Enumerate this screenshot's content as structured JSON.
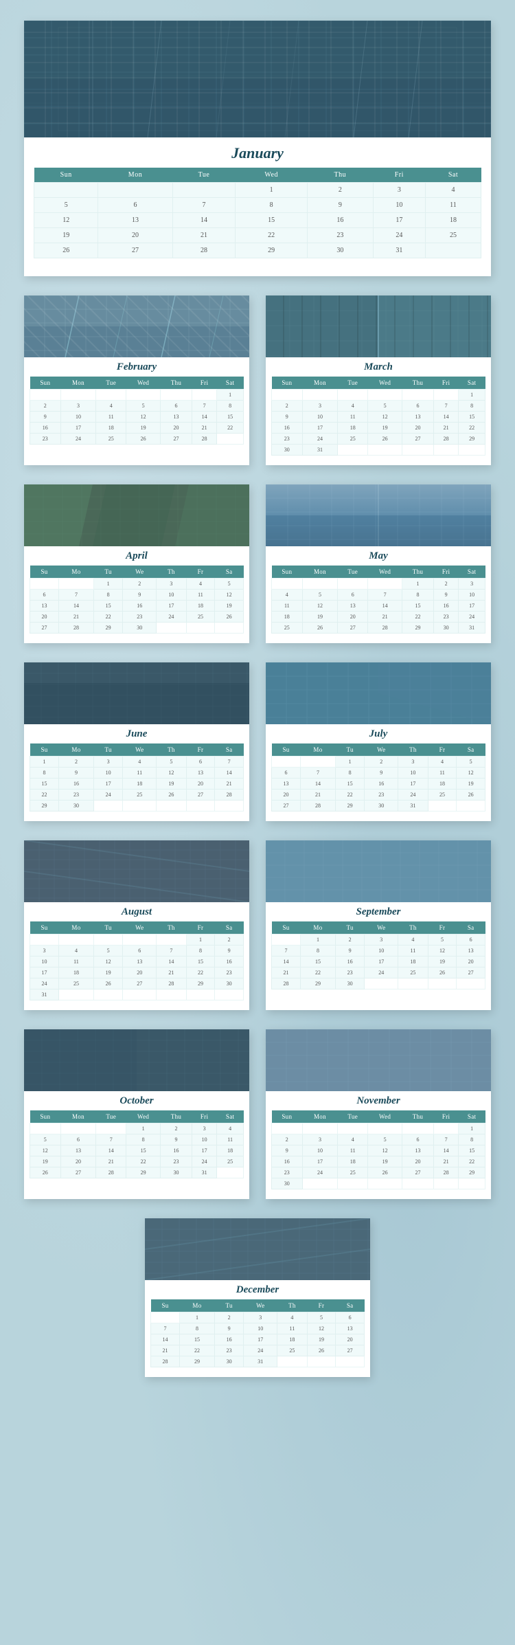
{
  "months": {
    "january": {
      "name": "January",
      "headers_full": [
        "Sun",
        "Mon",
        "Tue",
        "Wed",
        "Thu",
        "Fri",
        "Sat"
      ],
      "weeks": [
        [
          "",
          "",
          "",
          "1",
          "2",
          "3",
          "4"
        ],
        [
          "5",
          "6",
          "7",
          "8",
          "9",
          "10",
          "11"
        ],
        [
          "12",
          "13",
          "14",
          "15",
          "16",
          "17",
          "18"
        ],
        [
          "19",
          "20",
          "21",
          "22",
          "23",
          "24",
          "25"
        ],
        [
          "26",
          "27",
          "28",
          "29",
          "30",
          "31",
          ""
        ]
      ]
    },
    "february": {
      "name": "February",
      "headers": [
        "Sun",
        "Mon",
        "Tue",
        "Wed",
        "Thu",
        "Fri",
        "Sat"
      ],
      "weeks": [
        [
          "",
          "",
          "",
          "",
          "",
          "",
          "1"
        ],
        [
          "2",
          "3",
          "4",
          "5",
          "6",
          "7",
          "8"
        ],
        [
          "9",
          "10",
          "11",
          "12",
          "13",
          "14",
          "15"
        ],
        [
          "16",
          "17",
          "18",
          "19",
          "20",
          "21",
          "22"
        ],
        [
          "23",
          "24",
          "25",
          "26",
          "27",
          "28",
          ""
        ]
      ]
    },
    "march": {
      "name": "March",
      "headers": [
        "Sun",
        "Mon",
        "Tue",
        "Wed",
        "Thu",
        "Fri",
        "Sat"
      ],
      "weeks": [
        [
          "",
          "",
          "",
          "",
          "",
          "",
          "1"
        ],
        [
          "2",
          "3",
          "4",
          "5",
          "6",
          "7",
          "8"
        ],
        [
          "9",
          "10",
          "11",
          "12",
          "13",
          "14",
          "15"
        ],
        [
          "16",
          "17",
          "18",
          "19",
          "20",
          "21",
          "22"
        ],
        [
          "23",
          "24",
          "25",
          "26",
          "27",
          "28",
          "29"
        ],
        [
          "30",
          "31",
          "",
          "",
          "",
          "",
          ""
        ]
      ]
    },
    "april": {
      "name": "April",
      "headers": [
        "Su",
        "Mo",
        "Tu",
        "We",
        "Th",
        "Fr",
        "Sa"
      ],
      "weeks": [
        [
          "",
          "",
          "1",
          "2",
          "3",
          "4",
          "5"
        ],
        [
          "6",
          "7",
          "8",
          "9",
          "10",
          "11",
          "12"
        ],
        [
          "13",
          "14",
          "15",
          "16",
          "17",
          "18",
          "19"
        ],
        [
          "20",
          "21",
          "22",
          "23",
          "24",
          "25",
          "26"
        ],
        [
          "27",
          "28",
          "29",
          "30",
          "",
          "",
          ""
        ]
      ]
    },
    "may": {
      "name": "May",
      "headers": [
        "Sun",
        "Mon",
        "Tue",
        "Wed",
        "Thu",
        "Fri",
        "Sat"
      ],
      "weeks": [
        [
          "",
          "",
          "",
          "",
          "1",
          "2",
          "3"
        ],
        [
          "4",
          "5",
          "6",
          "7",
          "8",
          "9",
          "10"
        ],
        [
          "11",
          "12",
          "13",
          "14",
          "15",
          "16",
          "17"
        ],
        [
          "18",
          "19",
          "20",
          "21",
          "22",
          "23",
          "24"
        ],
        [
          "25",
          "26",
          "27",
          "28",
          "29",
          "30",
          "31"
        ]
      ]
    },
    "june": {
      "name": "June",
      "headers": [
        "Su",
        "Mo",
        "Tu",
        "We",
        "Th",
        "Fr",
        "Sa"
      ],
      "weeks": [
        [
          "1",
          "2",
          "3",
          "4",
          "5",
          "6",
          "7"
        ],
        [
          "8",
          "9",
          "10",
          "11",
          "12",
          "13",
          "14"
        ],
        [
          "15",
          "16",
          "17",
          "18",
          "19",
          "20",
          "21"
        ],
        [
          "22",
          "23",
          "24",
          "25",
          "26",
          "27",
          "28"
        ],
        [
          "29",
          "30",
          "",
          "",
          "",
          "",
          ""
        ]
      ]
    },
    "july": {
      "name": "July",
      "headers": [
        "Su",
        "Mo",
        "Tu",
        "We",
        "Th",
        "Fr",
        "Sa"
      ],
      "weeks": [
        [
          "",
          "",
          "1",
          "2",
          "3",
          "4",
          "5"
        ],
        [
          "6",
          "7",
          "8",
          "9",
          "10",
          "11",
          "12"
        ],
        [
          "13",
          "14",
          "15",
          "16",
          "17",
          "18",
          "19"
        ],
        [
          "20",
          "21",
          "22",
          "23",
          "24",
          "25",
          "26"
        ],
        [
          "27",
          "28",
          "29",
          "30",
          "31",
          "",
          ""
        ]
      ]
    },
    "august": {
      "name": "August",
      "headers": [
        "Su",
        "Mo",
        "Tu",
        "We",
        "Th",
        "Fr",
        "Sa"
      ],
      "weeks": [
        [
          "",
          "",
          "",
          "",
          "",
          "1",
          "2"
        ],
        [
          "3",
          "4",
          "5",
          "6",
          "7",
          "8",
          "9"
        ],
        [
          "10",
          "11",
          "12",
          "13",
          "14",
          "15",
          "16"
        ],
        [
          "17",
          "18",
          "19",
          "20",
          "21",
          "22",
          "23"
        ],
        [
          "24",
          "25",
          "26",
          "27",
          "28",
          "29",
          "30"
        ],
        [
          "31",
          "",
          "",
          "",
          "",
          "",
          ""
        ]
      ]
    },
    "september": {
      "name": "September",
      "headers": [
        "Su",
        "Mo",
        "Tu",
        "We",
        "Th",
        "Fr",
        "Sa"
      ],
      "weeks": [
        [
          "",
          "1",
          "2",
          "3",
          "4",
          "5",
          "6"
        ],
        [
          "7",
          "8",
          "9",
          "10",
          "11",
          "12",
          "13"
        ],
        [
          "14",
          "15",
          "16",
          "17",
          "18",
          "19",
          "20"
        ],
        [
          "21",
          "22",
          "23",
          "24",
          "25",
          "26",
          "27"
        ],
        [
          "28",
          "29",
          "30",
          "",
          "",
          "",
          ""
        ]
      ]
    },
    "october": {
      "name": "October",
      "headers": [
        "Sun",
        "Mon",
        "Tue",
        "Wed",
        "Thu",
        "Fri",
        "Sat"
      ],
      "weeks": [
        [
          "",
          "",
          "",
          "1",
          "2",
          "3",
          "4"
        ],
        [
          "5",
          "6",
          "7",
          "8",
          "9",
          "10",
          "11"
        ],
        [
          "12",
          "13",
          "14",
          "15",
          "16",
          "17",
          "18"
        ],
        [
          "19",
          "20",
          "21",
          "22",
          "23",
          "24",
          "25"
        ],
        [
          "26",
          "27",
          "28",
          "29",
          "30",
          "31",
          ""
        ]
      ]
    },
    "november": {
      "name": "November",
      "headers": [
        "Sun",
        "Mon",
        "Tue",
        "Wed",
        "Thu",
        "Fri",
        "Sat"
      ],
      "weeks": [
        [
          "",
          "",
          "",
          "",
          "",
          "",
          "1"
        ],
        [
          "2",
          "3",
          "4",
          "5",
          "6",
          "7",
          "8"
        ],
        [
          "9",
          "10",
          "11",
          "12",
          "13",
          "14",
          "15"
        ],
        [
          "16",
          "17",
          "18",
          "19",
          "20",
          "21",
          "22"
        ],
        [
          "23",
          "24",
          "25",
          "26",
          "27",
          "28",
          "29"
        ],
        [
          "30",
          "",
          "",
          "",
          "",
          "",
          ""
        ]
      ]
    },
    "december": {
      "name": "December",
      "headers": [
        "Su",
        "Mo",
        "Tu",
        "We",
        "Th",
        "Fr",
        "Sa"
      ],
      "weeks": [
        [
          "",
          "1",
          "2",
          "3",
          "4",
          "5",
          "6"
        ],
        [
          "7",
          "8",
          "9",
          "10",
          "11",
          "12",
          "13"
        ],
        [
          "14",
          "15",
          "16",
          "17",
          "18",
          "19",
          "20"
        ],
        [
          "21",
          "22",
          "23",
          "24",
          "25",
          "26",
          "27"
        ],
        [
          "28",
          "29",
          "30",
          "31",
          "",
          "",
          ""
        ]
      ]
    }
  }
}
